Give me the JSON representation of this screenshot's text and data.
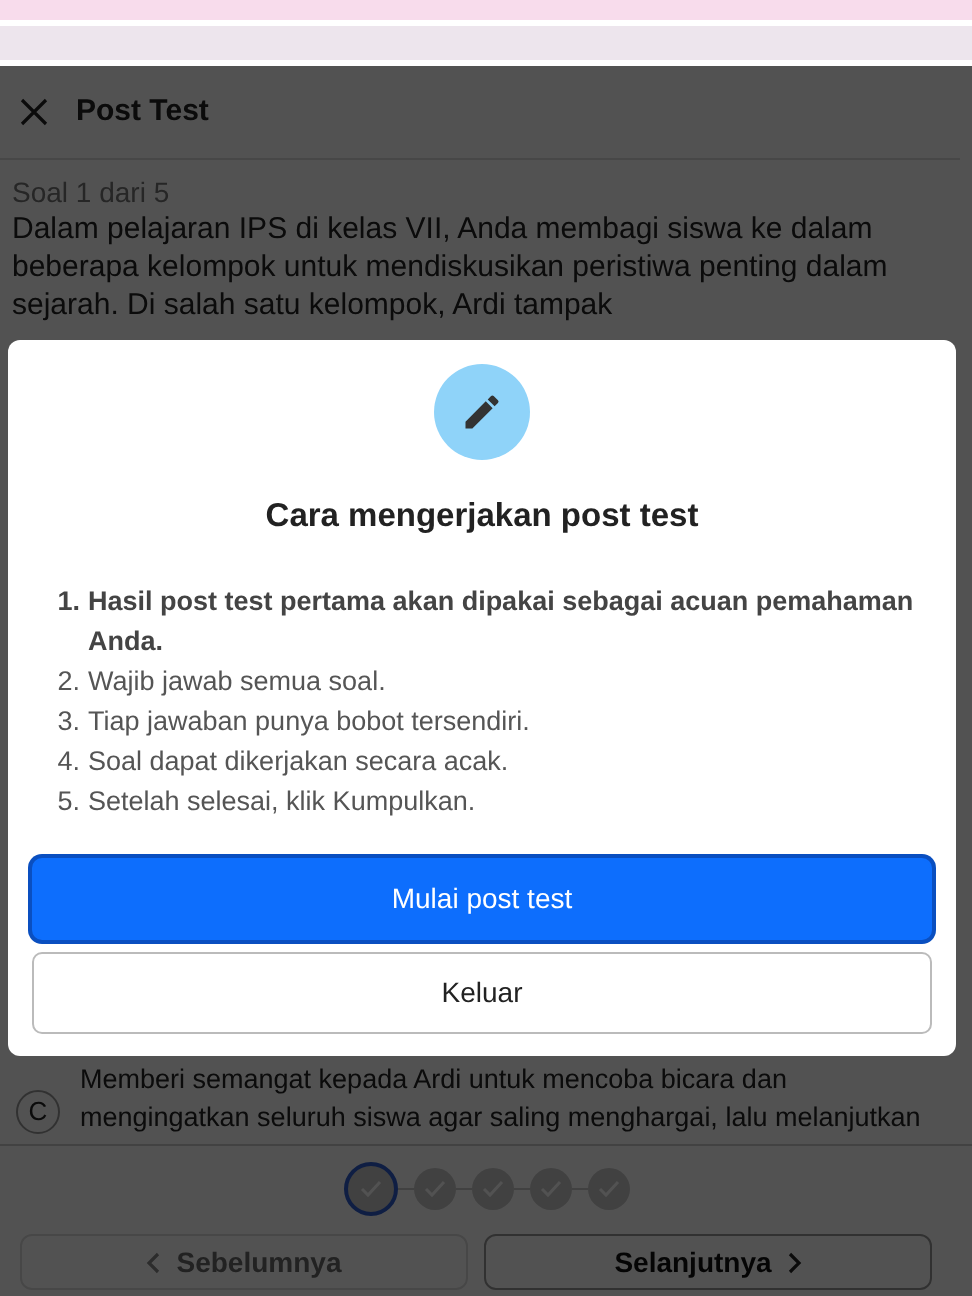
{
  "header": {
    "title": "Post Test"
  },
  "question": {
    "counter": "Soal 1 dari 5",
    "text": "Dalam pelajaran IPS di kelas VII, Anda membagi siswa ke dalam beberapa kelompok untuk mendiskusikan peristiwa penting dalam sejarah. Di salah satu kelompok, Ardi tampak"
  },
  "options": [
    {
      "letter": "C",
      "text": "Memberi semangat kepada Ardi untuk mencoba bicara dan mengingatkan seluruh siswa agar saling menghargai, lalu melanjutkan",
      "selected": false
    }
  ],
  "modal": {
    "title": "Cara mengerjakan post test",
    "steps": [
      {
        "number": "1.",
        "text": "Hasil post test pertama akan dipakai sebagai acuan pemahaman Anda.",
        "bold": true
      },
      {
        "number": "2.",
        "text": "Wajib jawab semua soal.",
        "bold": false
      },
      {
        "number": "3.",
        "text": "Tiap jawaban punya bobot tersendiri.",
        "bold": false
      },
      {
        "number": "4.",
        "text": "Soal dapat dikerjakan secara acak.",
        "bold": false
      },
      {
        "number": "5.",
        "text": "Setelah selesai, klik Kumpulkan.",
        "bold": false
      }
    ],
    "buttons": [
      {
        "label": "Mulai post test",
        "kind": "primary",
        "focused": true
      },
      {
        "label": "Keluar",
        "kind": "secondary",
        "focused": false
      }
    ]
  },
  "stepper": [
    {
      "selected": true
    },
    {
      "selected": false
    },
    {
      "selected": false
    },
    {
      "selected": false
    },
    {
      "selected": false
    }
  ],
  "nav": [
    {
      "label": "Sebelumnya",
      "kind": "prev",
      "disabled": true
    },
    {
      "label": "Selanjutnya",
      "kind": "next",
      "disabled": false
    }
  ]
}
